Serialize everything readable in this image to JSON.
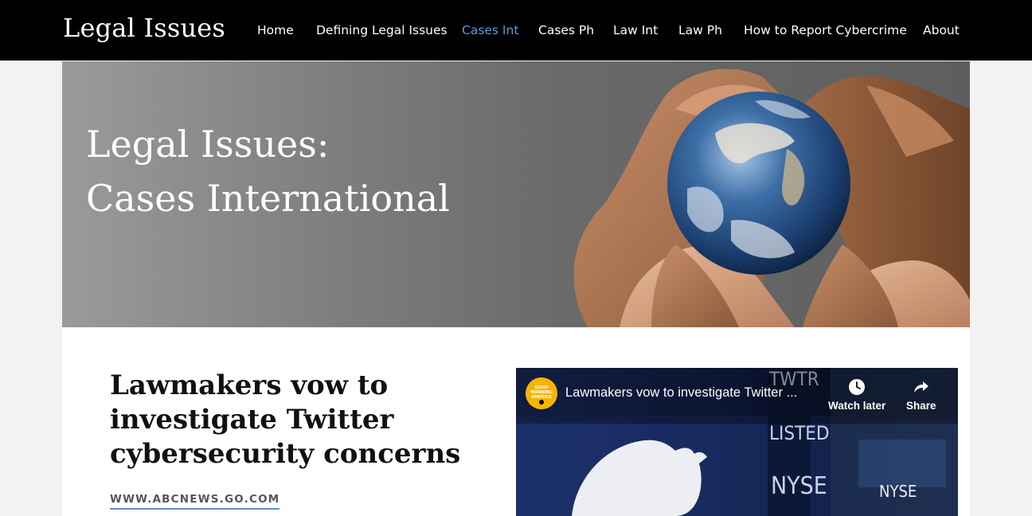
{
  "site": {
    "title": "Legal Issues"
  },
  "nav": {
    "items": [
      {
        "label": "Home",
        "active": false
      },
      {
        "label": "Defining Legal Issues",
        "active": false
      },
      {
        "label": "Cases Int",
        "active": true
      },
      {
        "label": "Cases Ph",
        "active": false
      },
      {
        "label": "Law Int",
        "active": false
      },
      {
        "label": "Law Ph",
        "active": false
      },
      {
        "label": "How to Report Cybercrime",
        "active": false
      },
      {
        "label": "About",
        "active": false
      }
    ]
  },
  "hero": {
    "title_line1": "Legal Issues:",
    "title_line2": "Cases International"
  },
  "article": {
    "headline": "Lawmakers vow to investigate Twitter cybersecurity concerns",
    "source": "WWW.ABCNEWS.GO.COM"
  },
  "video": {
    "title": "Lawmakers vow to investigate Twitter ...",
    "watch_later_label": "Watch later",
    "share_label": "Share",
    "channel_logo_text": [
      "GOOD",
      "MORNING",
      "AMERICA"
    ],
    "background_signs": [
      "TWTR",
      "LISTED",
      "NYSE",
      "NYSE"
    ]
  },
  "colors": {
    "topbar": "#000000",
    "nav_active": "#5b9bd5",
    "source_underline": "#5b8fc7"
  }
}
